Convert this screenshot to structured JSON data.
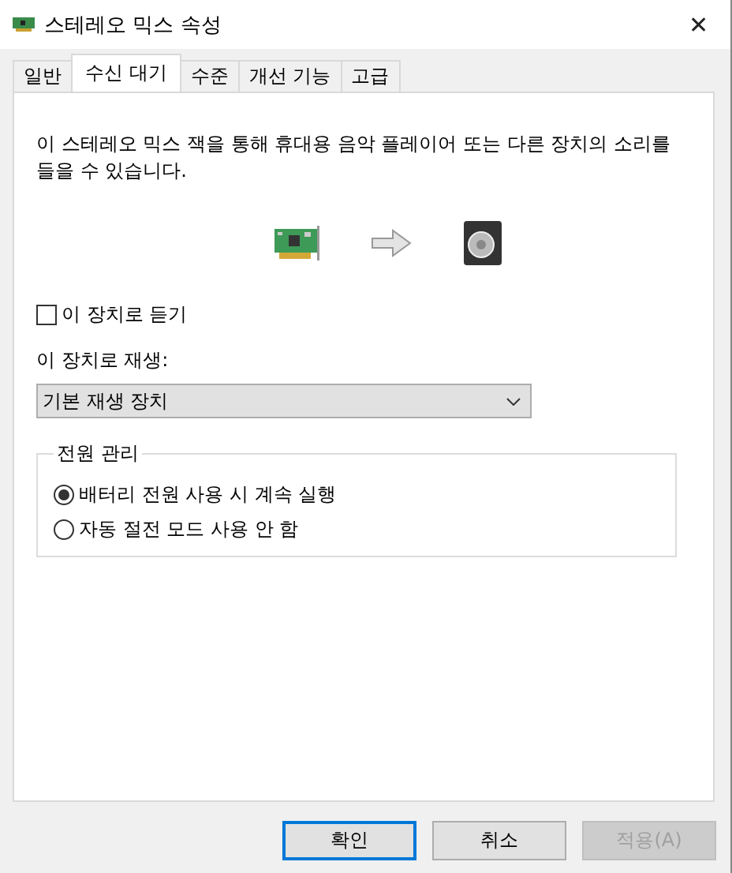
{
  "window": {
    "title": "스테레오 믹스 속성",
    "close": "✕"
  },
  "tabs": [
    {
      "label": "일반",
      "selected": false
    },
    {
      "label": "수신 대기",
      "selected": true
    },
    {
      "label": "수준",
      "selected": false
    },
    {
      "label": "개선 기능",
      "selected": false
    },
    {
      "label": "고급",
      "selected": false
    }
  ],
  "description": "이 스테레오 믹스 잭을 통해 휴대용 음악 플레이어 또는 다른 장치의 소리를 들을 수 있습니다.",
  "listen": {
    "label": "이 장치로 듣기",
    "checked": false
  },
  "playback": {
    "label": "이 장치로 재생:",
    "value": "기본 재생 장치"
  },
  "power": {
    "title": "전원 관리",
    "options": [
      {
        "label": "배터리 전원 사용 시 계속 실행",
        "selected": true
      },
      {
        "label": "자동 절전 모드 사용 안 함",
        "selected": false
      }
    ]
  },
  "buttons": [
    {
      "label": "확인",
      "kind": "default",
      "disabled": false
    },
    {
      "label": "취소",
      "kind": "normal",
      "disabled": false
    },
    {
      "label": "적용(A)",
      "kind": "normal",
      "disabled": true
    }
  ]
}
